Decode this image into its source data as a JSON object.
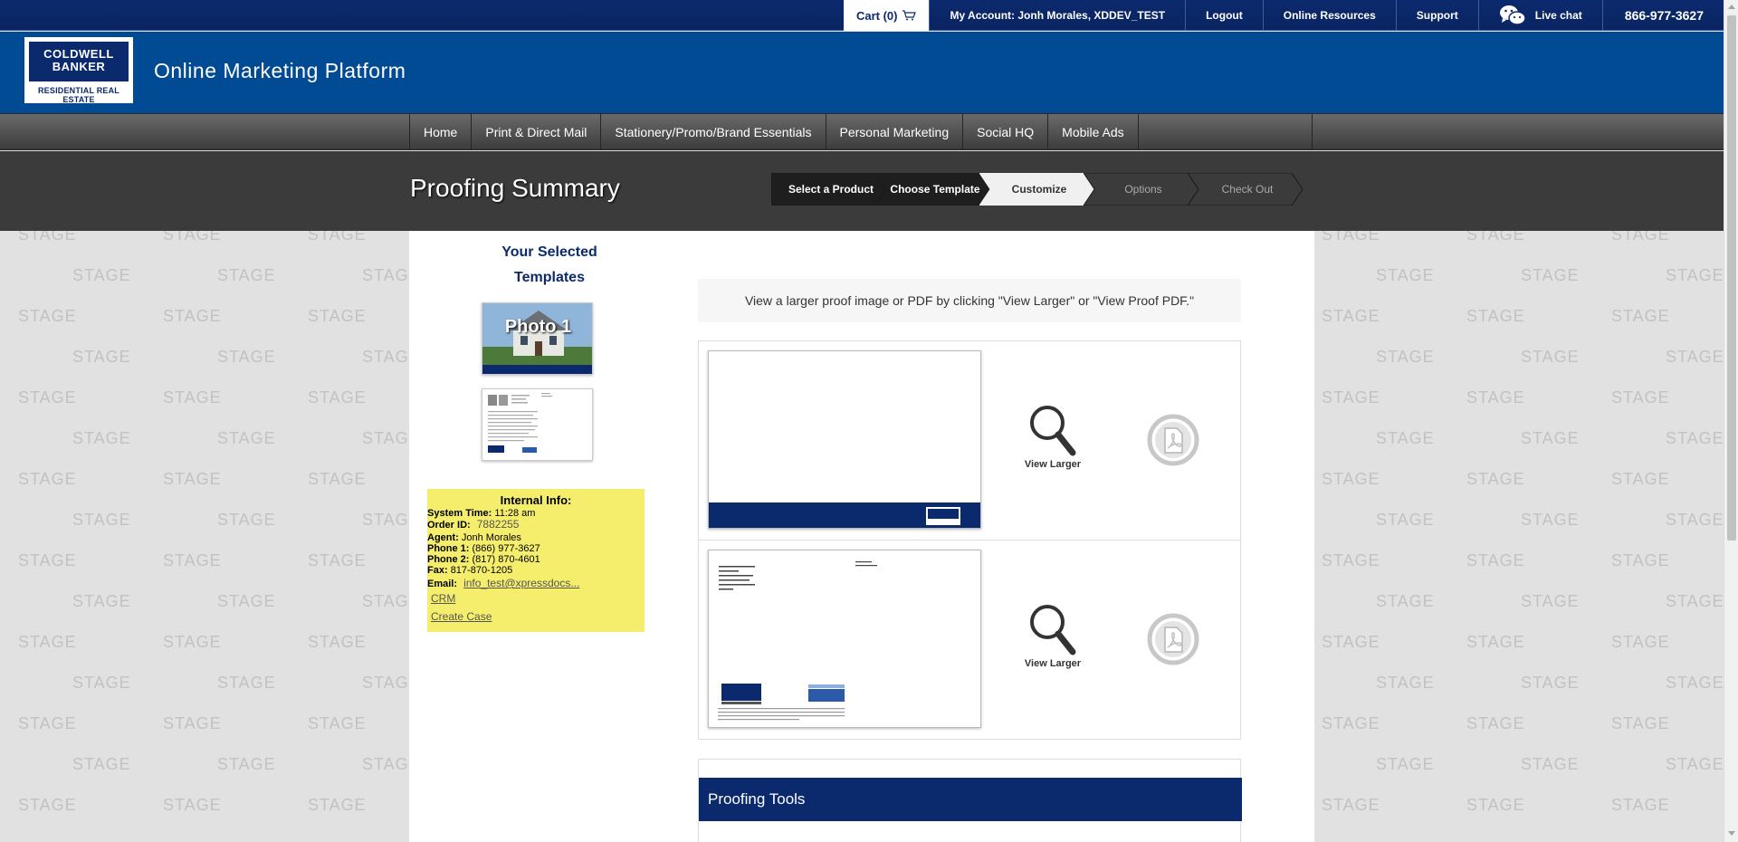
{
  "topbar": {
    "cart_label": "Cart (0)",
    "account_label": "My Account: Jonh Morales, XDDEV_TEST",
    "logout_label": "Logout",
    "online_resources_label": "Online Resources",
    "support_label": "Support",
    "live_chat_label": "Live chat",
    "phone": "866-977-3627"
  },
  "header": {
    "logo_line1": "COLDWELL",
    "logo_line2": "BANKER",
    "logo_sub": "RESIDENTIAL REAL ESTATE",
    "title": "Online Marketing Platform"
  },
  "nav": {
    "items": [
      {
        "label": "Home"
      },
      {
        "label": "Print & Direct Mail"
      },
      {
        "label": "Stationery/Promo/Brand Essentials"
      },
      {
        "label": "Personal Marketing"
      },
      {
        "label": "Social HQ"
      },
      {
        "label": "Mobile Ads"
      }
    ]
  },
  "page": {
    "title": "Proofing Summary"
  },
  "steps": [
    {
      "label": "Select a Product",
      "state": "done"
    },
    {
      "label": "Choose Template",
      "state": "done"
    },
    {
      "label": "Customize",
      "state": "current"
    },
    {
      "label": "Options",
      "state": "pending"
    },
    {
      "label": "Check Out",
      "state": "pending"
    }
  ],
  "watermark": "STAGE",
  "selected_templates": {
    "title_line1": "Your Selected",
    "title_line2": "Templates",
    "thumb1_text": "Photo 1"
  },
  "internal_info": {
    "title": "Internal Info:",
    "system_time_label": "System Time:",
    "system_time": "11:28 am",
    "order_id_label": "Order ID:",
    "order_id": "7882255",
    "agent_label": "Agent:",
    "agent": "Jonh Morales",
    "phone1_label": "Phone 1:",
    "phone1": "(866) 977-3627",
    "phone2_label": "Phone 2:",
    "phone2": "(817) 870-4601",
    "fax_label": "Fax:",
    "fax": "817-870-1205",
    "email_label": "Email:",
    "email": "info_test@xpressdocs...",
    "crm_label": "CRM",
    "create_case_label": "Create Case"
  },
  "proofing": {
    "instructions": "View a larger proof image or PDF by clicking \"View Larger\" or \"View Proof PDF.\"",
    "view_larger_label": "View Larger",
    "tools_title": "Proofing Tools"
  },
  "colors": {
    "brand_navy": "#0b2a6e",
    "header_blue": "#004b93",
    "note_yellow": "#f4ee6c"
  }
}
